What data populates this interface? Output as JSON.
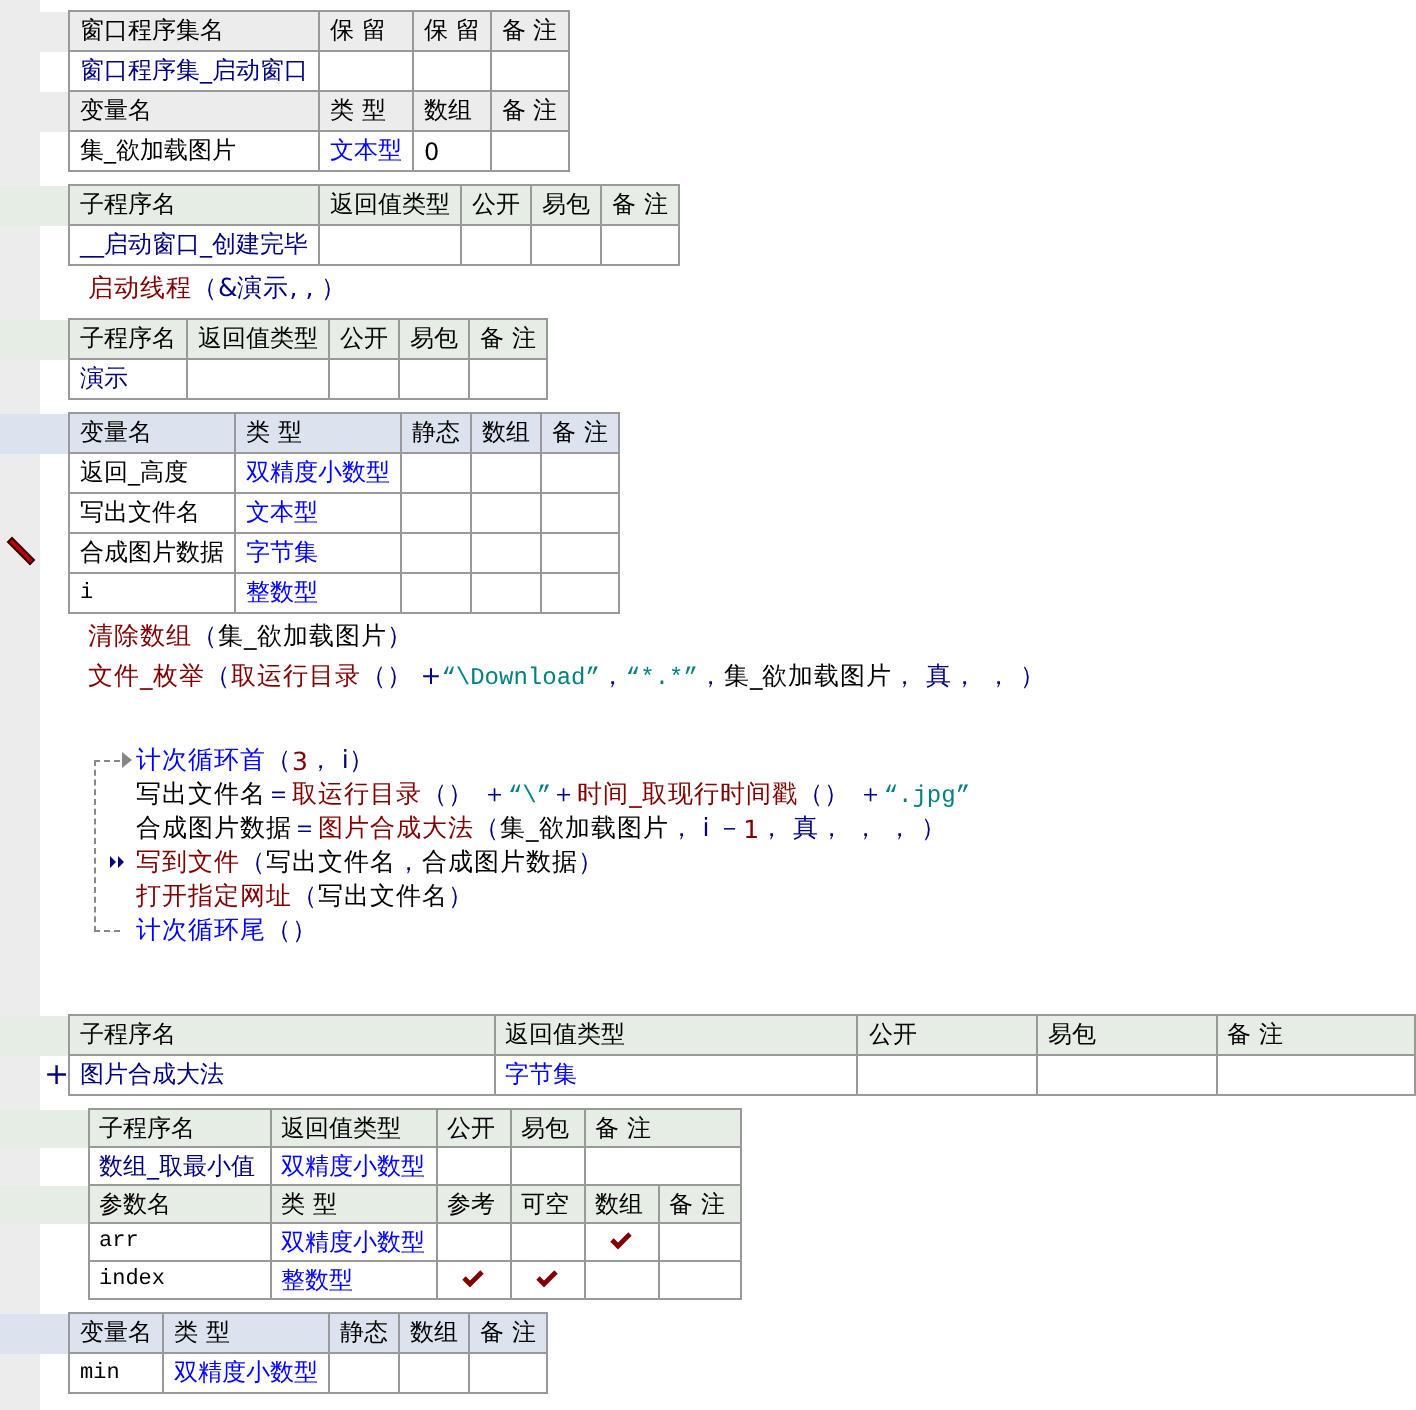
{
  "blocks": [
    {
      "kind": "assembly-table",
      "rows": [
        {
          "kind": "header",
          "cells": [
            {
              "text": "窗口程序集名"
            },
            {
              "text": "保 留"
            },
            {
              "text": "保 留"
            },
            {
              "text": "备 注"
            }
          ]
        },
        {
          "kind": "data",
          "cells": [
            {
              "kind": "name",
              "text": "窗口程序集_启动窗口"
            },
            {
              "kind": "empty"
            },
            {
              "kind": "empty"
            },
            {
              "kind": "empty"
            }
          ]
        },
        {
          "kind": "header",
          "cells": [
            {
              "text": "变量名"
            },
            {
              "text": "类 型"
            },
            {
              "text": "数组"
            },
            {
              "text": "备 注"
            }
          ]
        },
        {
          "kind": "data",
          "cells": [
            {
              "kind": "plain",
              "text": "集_欲加载图片"
            },
            {
              "kind": "type",
              "text": "文本型"
            },
            {
              "kind": "plain",
              "text": "0"
            },
            {
              "kind": "empty"
            }
          ]
        }
      ]
    },
    {
      "kind": "sub-table",
      "rows": [
        {
          "kind": "header",
          "cells": [
            {
              "text": "子程序名"
            },
            {
              "text": "返回值类型"
            },
            {
              "text": "公开"
            },
            {
              "text": "易包"
            },
            {
              "text": "备 注"
            }
          ]
        },
        {
          "kind": "data",
          "cells": [
            {
              "kind": "name",
              "text": "__启动窗口_创建完毕"
            },
            {
              "kind": "empty"
            },
            {
              "kind": "empty"
            },
            {
              "kind": "empty"
            },
            {
              "kind": "empty"
            }
          ]
        }
      ]
    },
    {
      "kind": "code",
      "segments": [
        {
          "kind": "cmd",
          "text": "启动线程"
        },
        {
          "kind": "punct",
          "text": "（&演示, , ）"
        }
      ]
    },
    {
      "kind": "sub-table",
      "rows": [
        {
          "kind": "header",
          "cells": [
            {
              "text": "子程序名"
            },
            {
              "text": "返回值类型"
            },
            {
              "text": "公开"
            },
            {
              "text": "易包"
            },
            {
              "text": "备 注"
            }
          ]
        },
        {
          "kind": "data",
          "cells": [
            {
              "kind": "name",
              "text": "演示"
            },
            {
              "kind": "empty"
            },
            {
              "kind": "empty"
            },
            {
              "kind": "empty"
            },
            {
              "kind": "empty"
            }
          ]
        }
      ]
    },
    {
      "kind": "vars-table",
      "rows": [
        {
          "kind": "header",
          "cells": [
            {
              "text": "变量名"
            },
            {
              "text": "类 型"
            },
            {
              "text": "静态"
            },
            {
              "text": "数组"
            },
            {
              "text": "备 注"
            }
          ]
        },
        {
          "kind": "data",
          "cells": [
            {
              "kind": "plain",
              "text": "返回_高度"
            },
            {
              "kind": "type",
              "text": "双精度小数型"
            },
            {
              "kind": "empty"
            },
            {
              "kind": "empty"
            },
            {
              "kind": "empty"
            }
          ]
        },
        {
          "kind": "data",
          "cells": [
            {
              "kind": "plain",
              "text": "写出文件名"
            },
            {
              "kind": "type",
              "text": "文本型"
            },
            {
              "kind": "empty"
            },
            {
              "kind": "empty"
            },
            {
              "kind": "empty"
            }
          ]
        },
        {
          "kind": "data",
          "gutter": {
            "kind": "pencil"
          },
          "cells": [
            {
              "kind": "plain",
              "text": "合成图片数据"
            },
            {
              "kind": "type",
              "text": "字节集"
            },
            {
              "kind": "empty"
            },
            {
              "kind": "empty"
            },
            {
              "kind": "empty"
            }
          ]
        },
        {
          "kind": "data",
          "cells": [
            {
              "kind": "mono",
              "text": "i"
            },
            {
              "kind": "type",
              "text": "整数型"
            },
            {
              "kind": "empty"
            },
            {
              "kind": "empty"
            },
            {
              "kind": "empty"
            }
          ]
        }
      ]
    },
    {
      "kind": "code",
      "segments": [
        {
          "kind": "cmd",
          "text": "清除数组"
        },
        {
          "kind": "punct",
          "text": "（"
        },
        {
          "kind": "var",
          "text": "集_欲加载图片"
        },
        {
          "kind": "punct",
          "text": "）"
        }
      ]
    },
    {
      "kind": "code",
      "segments": [
        {
          "kind": "cmd",
          "text": "文件_枚举"
        },
        {
          "kind": "punct",
          "text": "（"
        },
        {
          "kind": "cmd",
          "text": "取运行目录"
        },
        {
          "kind": "punct",
          "text": "（） + "
        },
        {
          "kind": "str",
          "text": "“\\Download”"
        },
        {
          "kind": "punct",
          "text": "， "
        },
        {
          "kind": "str",
          "text": "“*.*”"
        },
        {
          "kind": "punct",
          "text": "， "
        },
        {
          "kind": "var",
          "text": "集_欲加载图片"
        },
        {
          "kind": "punct",
          "text": "， 真， ， ）"
        }
      ]
    },
    {
      "kind": "blank"
    },
    {
      "kind": "loop",
      "head": [
        {
          "kind": "flow",
          "text": "计次循环首"
        },
        {
          "kind": "punct",
          "text": "（"
        },
        {
          "kind": "num",
          "text": "3"
        },
        {
          "kind": "punct",
          "text": "， i）"
        }
      ],
      "body": [
        {
          "segments": [
            {
              "kind": "var",
              "text": "写出文件名"
            },
            {
              "kind": "punct",
              "text": " ＝ "
            },
            {
              "kind": "cmd",
              "text": "取运行目录"
            },
            {
              "kind": "punct",
              "text": "（） ＋ "
            },
            {
              "kind": "str",
              "text": "“\\”"
            },
            {
              "kind": "punct",
              "text": " ＋ "
            },
            {
              "kind": "cmd",
              "text": "时间_取现行时间戳"
            },
            {
              "kind": "punct",
              "text": "（） ＋ "
            },
            {
              "kind": "str",
              "text": "“.jpg”"
            }
          ]
        },
        {
          "segments": [
            {
              "kind": "var",
              "text": "合成图片数据"
            },
            {
              "kind": "punct",
              "text": " ＝ "
            },
            {
              "kind": "cmd",
              "text": "图片合成大法"
            },
            {
              "kind": "punct",
              "text": "（"
            },
            {
              "kind": "var",
              "text": "集_欲加载图片"
            },
            {
              "kind": "punct",
              "text": "， i － "
            },
            {
              "kind": "num",
              "text": "1"
            },
            {
              "kind": "punct",
              "text": "， 真， ， ， ）"
            }
          ]
        },
        {
          "gutter": {
            "kind": "arrows"
          },
          "segments": [
            {
              "kind": "cmd",
              "text": "写到文件"
            },
            {
              "kind": "punct",
              "text": "（"
            },
            {
              "kind": "var",
              "text": "写出文件名"
            },
            {
              "kind": "punct",
              "text": "， "
            },
            {
              "kind": "var",
              "text": "合成图片数据"
            },
            {
              "kind": "punct",
              "text": "）"
            }
          ]
        },
        {
          "segments": [
            {
              "kind": "cmd",
              "text": "打开指定网址"
            },
            {
              "kind": "punct",
              "text": "（"
            },
            {
              "kind": "var",
              "text": "写出文件名"
            },
            {
              "kind": "punct",
              "text": "）"
            }
          ]
        }
      ],
      "tail": [
        {
          "kind": "flow",
          "text": "计次循环尾"
        },
        {
          "kind": "punct",
          "text": "（）"
        }
      ]
    },
    {
      "kind": "blank"
    },
    {
      "kind": "collapsed-sub-table",
      "rows": [
        {
          "kind": "header",
          "cells": [
            {
              "text": "子程序名"
            },
            {
              "text": "返回值类型"
            },
            {
              "text": "公开"
            },
            {
              "text": "易包"
            },
            {
              "text": "备 注"
            }
          ]
        },
        {
          "kind": "data",
          "gutter": {
            "kind": "plus",
            "text": "+"
          },
          "cells": [
            {
              "kind": "name",
              "text": "图片合成大法"
            },
            {
              "kind": "type",
              "text": "字节集"
            },
            {
              "kind": "empty"
            },
            {
              "kind": "empty"
            },
            {
              "kind": "empty"
            }
          ]
        }
      ]
    },
    {
      "kind": "sub-table",
      "rows": [
        {
          "kind": "header",
          "cells": [
            {
              "text": "子程序名"
            },
            {
              "text": "返回值类型"
            },
            {
              "text": "公开"
            },
            {
              "text": "易包"
            },
            {
              "text": "备 注"
            }
          ]
        },
        {
          "kind": "data",
          "cells": [
            {
              "kind": "name",
              "text": "数组_取最小值"
            },
            {
              "kind": "type",
              "text": "双精度小数型"
            },
            {
              "kind": "empty"
            },
            {
              "kind": "empty"
            },
            {
              "kind": "empty"
            }
          ]
        }
      ]
    },
    {
      "kind": "params-table",
      "rows": [
        {
          "kind": "header",
          "cells": [
            {
              "text": "参数名"
            },
            {
              "text": "类 型"
            },
            {
              "text": "参考"
            },
            {
              "text": "可空"
            },
            {
              "text": "数组"
            },
            {
              "text": "备 注"
            }
          ]
        },
        {
          "kind": "data",
          "cells": [
            {
              "kind": "mono",
              "text": "arr"
            },
            {
              "kind": "type",
              "text": "双精度小数型"
            },
            {
              "kind": "check",
              "checked": false
            },
            {
              "kind": "check",
              "checked": false
            },
            {
              "kind": "check",
              "checked": true
            },
            {
              "kind": "empty"
            }
          ]
        },
        {
          "kind": "data",
          "cells": [
            {
              "kind": "mono",
              "text": "index"
            },
            {
              "kind": "type",
              "text": "整数型"
            },
            {
              "kind": "check",
              "checked": true
            },
            {
              "kind": "check",
              "checked": true
            },
            {
              "kind": "check",
              "checked": false
            },
            {
              "kind": "empty"
            }
          ]
        }
      ]
    },
    {
      "kind": "vars-table",
      "rows": [
        {
          "kind": "header",
          "cells": [
            {
              "text": "变量名"
            },
            {
              "text": "类 型"
            },
            {
              "text": "静态"
            },
            {
              "text": "数组"
            },
            {
              "text": "备 注"
            }
          ]
        },
        {
          "kind": "data",
          "cells": [
            {
              "kind": "mono",
              "text": "min"
            },
            {
              "kind": "type",
              "text": "双精度小数型"
            },
            {
              "kind": "empty"
            },
            {
              "kind": "empty"
            },
            {
              "kind": "empty"
            }
          ]
        }
      ]
    }
  ]
}
